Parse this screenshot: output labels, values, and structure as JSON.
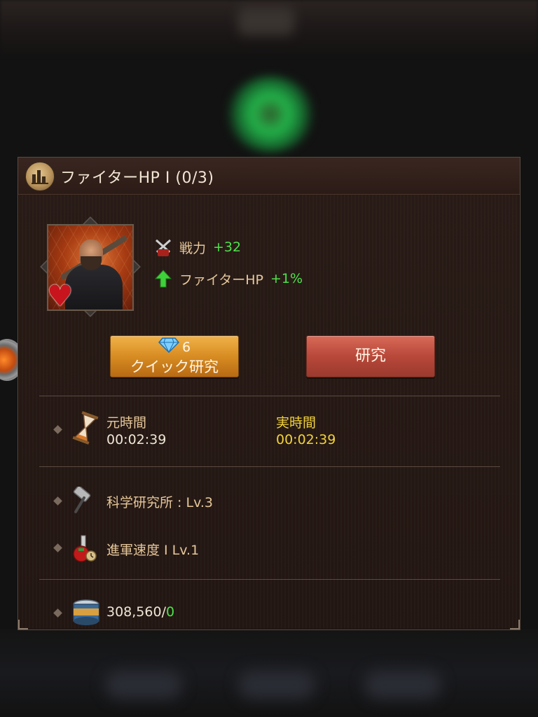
{
  "panel": {
    "title": "ファイターHP I (0/3)",
    "icon": "research-bars-icon"
  },
  "stats": [
    {
      "label": "戦力",
      "value": "+32",
      "icon": "power-swords-icon"
    },
    {
      "label": "ファイターHP",
      "value": "+1%",
      "icon": "green-up-arrow-icon"
    }
  ],
  "buttons": {
    "quick_cost": "6",
    "quick_label": "クイック研究",
    "research_label": "研究"
  },
  "time": {
    "original_label": "元時間",
    "original_value": "00:02:39",
    "actual_label": "実時間",
    "actual_value": "00:02:39"
  },
  "requirements": [
    {
      "text": "科学研究所 : Lv.3",
      "icon": "hammer-icon"
    },
    {
      "text": "進軍速度 I  Lv.1",
      "icon": "flask-icon"
    }
  ],
  "resource": {
    "have": "308,560/",
    "need": "0",
    "icon": "food-can-icon"
  },
  "colors": {
    "accent_green": "#4fe14a",
    "accent_yellow": "#f2d23a",
    "label_gold": "#e6c79a"
  }
}
